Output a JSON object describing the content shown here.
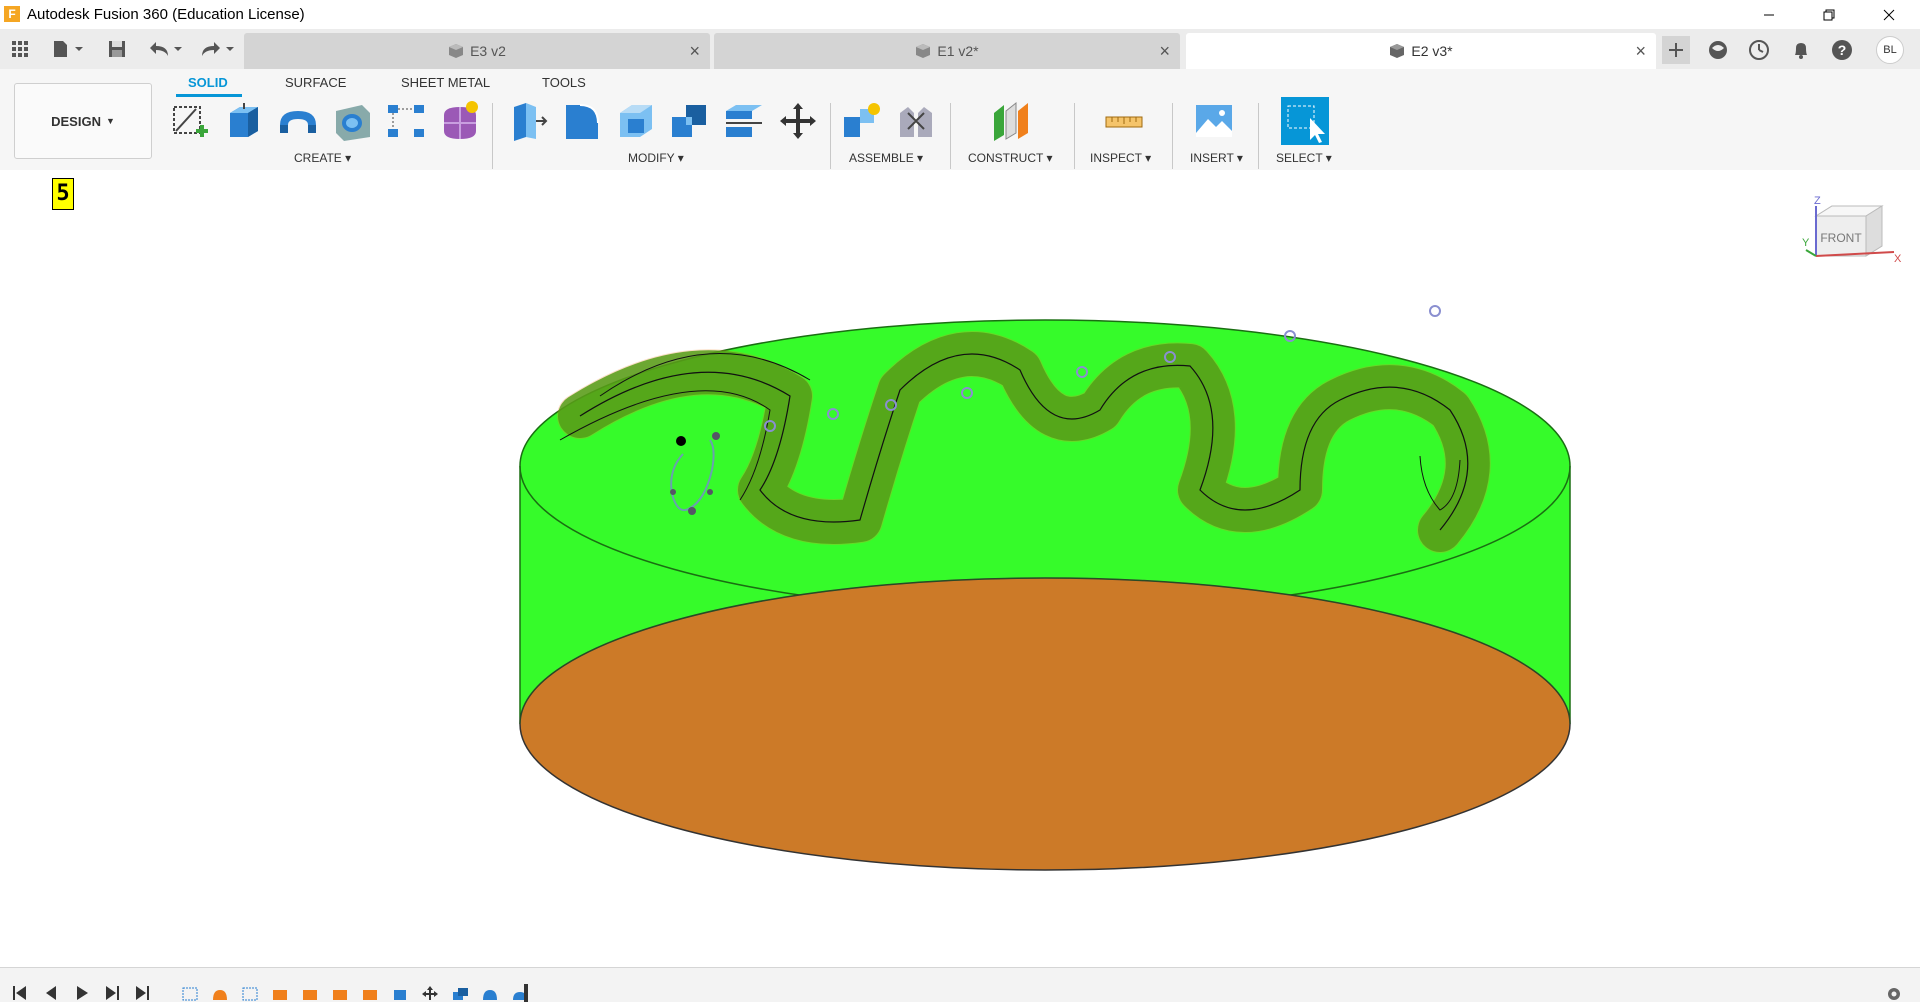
{
  "window": {
    "title": "Autodesk Fusion 360 (Education License)",
    "app_icon_letter": "F"
  },
  "tabs": [
    {
      "label": "E3 v2",
      "active": false
    },
    {
      "label": "E1 v2*",
      "active": false
    },
    {
      "label": "E2 v3*",
      "active": true
    }
  ],
  "user": {
    "initials": "BL"
  },
  "workspace": {
    "label": "DESIGN"
  },
  "ribbon_tabs": [
    "SOLID",
    "SURFACE",
    "SHEET METAL",
    "TOOLS"
  ],
  "groups": {
    "create": "CREATE",
    "modify": "MODIFY",
    "assemble": "ASSEMBLE",
    "construct": "CONSTRUCT",
    "inspect": "INSPECT",
    "insert": "INSERT",
    "select": "SELECT"
  },
  "viewport": {
    "badge": "5"
  },
  "viewcube": {
    "face": "FRONT",
    "z_axis": "Z",
    "x_axis": "X",
    "y_axis": "Y"
  },
  "colors": {
    "accent": "#0696d7",
    "body_green": "#33ff22",
    "bottom_face": "#cc7a28",
    "highlight_orange": "#f0801c"
  }
}
